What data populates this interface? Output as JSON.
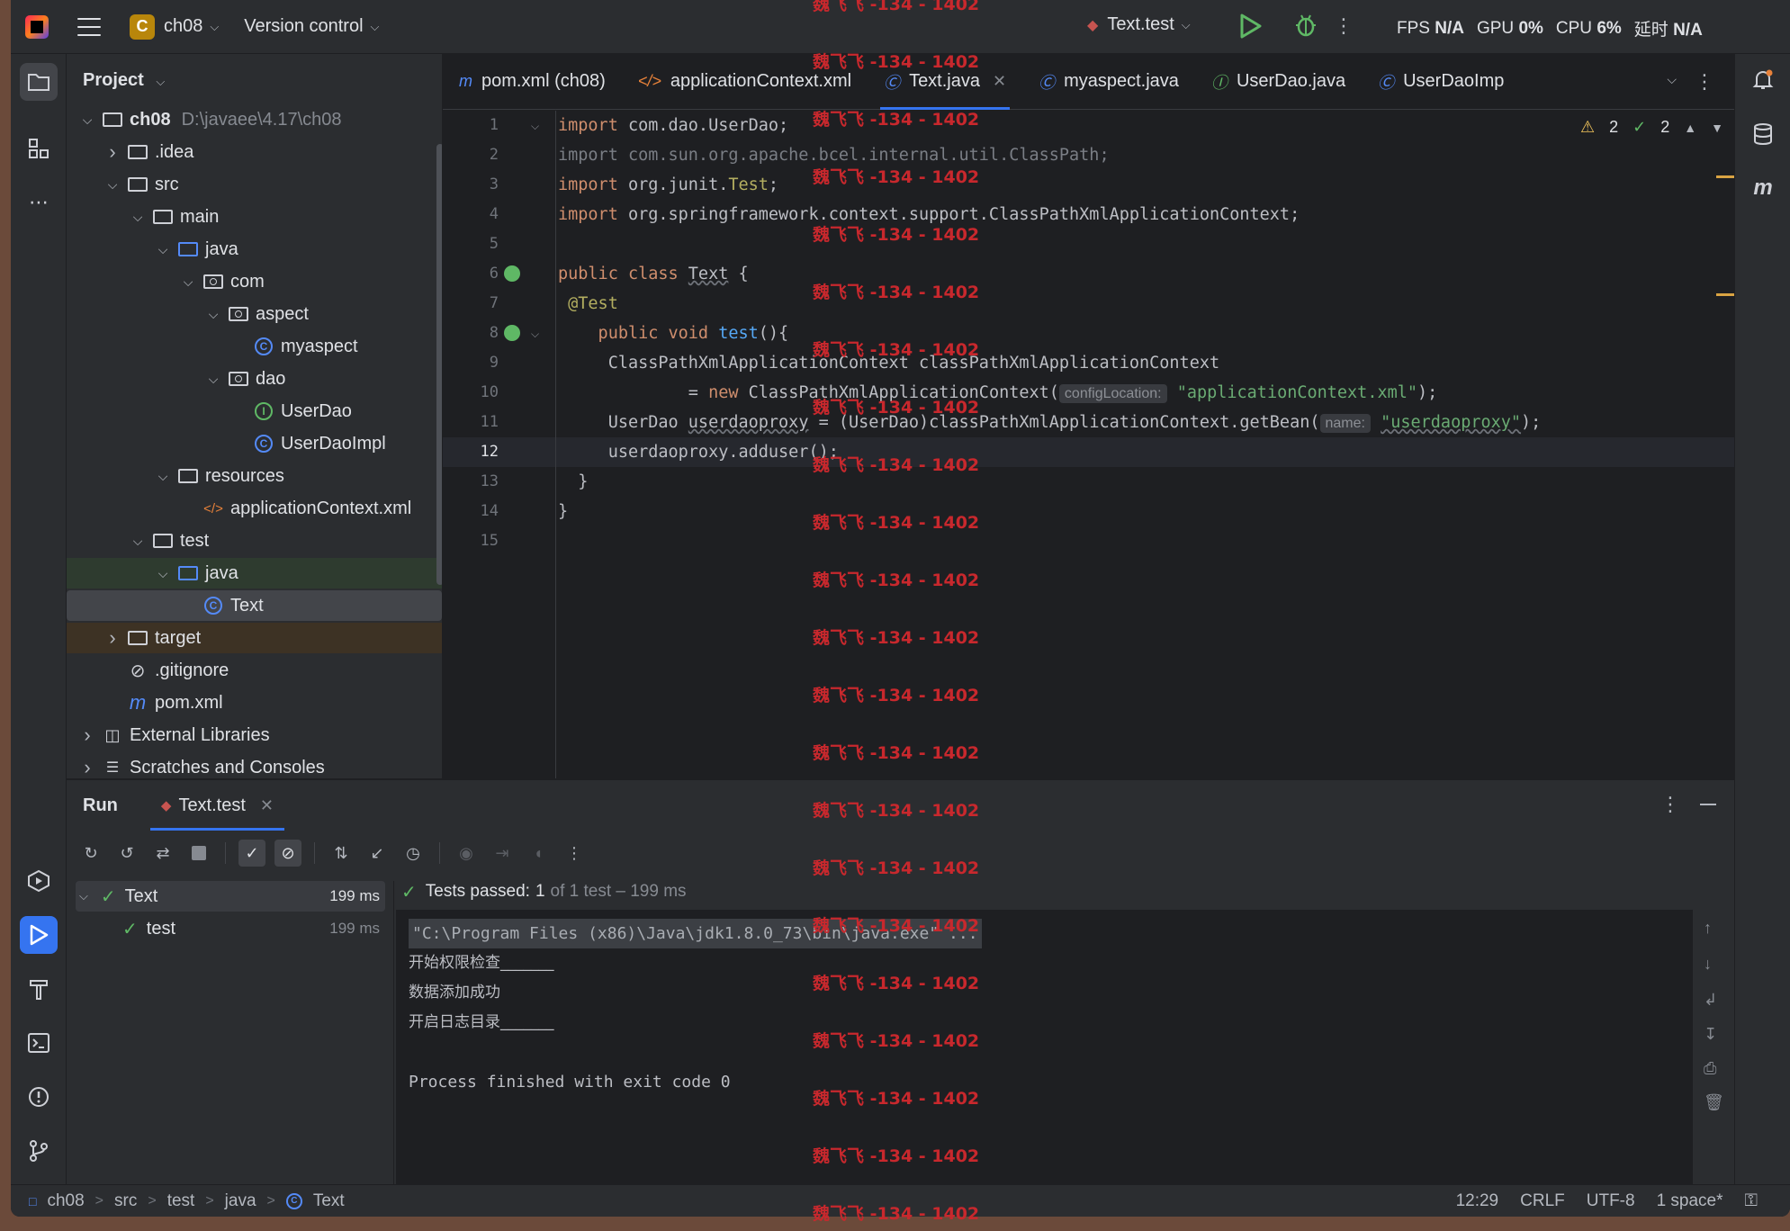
{
  "titlebar": {
    "project_badge": "C",
    "project_name": "ch08",
    "version_control": "Version control",
    "run_config": "Text.test",
    "perf": {
      "fps_label": "FPS",
      "fps_value": "N/A",
      "gpu_label": "GPU",
      "gpu_value": "0%",
      "cpu_label": "CPU",
      "cpu_value": "6%",
      "latency_label": "延时",
      "latency_value": "N/A"
    }
  },
  "project_panel": {
    "title": "Project",
    "tree": [
      {
        "label": "ch08",
        "path": "D:\\javaee\\4.17\\ch08",
        "type": "module",
        "depth": 0,
        "expanded": true
      },
      {
        "label": ".idea",
        "type": "folder",
        "depth": 1,
        "expanded": false
      },
      {
        "label": "src",
        "type": "folder",
        "depth": 1,
        "expanded": true
      },
      {
        "label": "main",
        "type": "folder",
        "depth": 2,
        "expanded": true
      },
      {
        "label": "java",
        "type": "source-folder",
        "depth": 3,
        "expanded": true
      },
      {
        "label": "com",
        "type": "package",
        "depth": 4,
        "expanded": true
      },
      {
        "label": "aspect",
        "type": "package",
        "depth": 5,
        "expanded": true
      },
      {
        "label": "myaspect",
        "type": "class",
        "depth": 6
      },
      {
        "label": "dao",
        "type": "package",
        "depth": 5,
        "expanded": true
      },
      {
        "label": "UserDao",
        "type": "interface",
        "depth": 6
      },
      {
        "label": "UserDaoImpl",
        "type": "class",
        "depth": 6
      },
      {
        "label": "resources",
        "type": "resources-folder",
        "depth": 3,
        "expanded": true
      },
      {
        "label": "applicationContext.xml",
        "type": "xml",
        "depth": 4
      },
      {
        "label": "test",
        "type": "folder",
        "depth": 2,
        "expanded": true
      },
      {
        "label": "java",
        "type": "test-folder",
        "depth": 3,
        "expanded": true
      },
      {
        "label": "Text",
        "type": "class",
        "depth": 4,
        "selected": true
      },
      {
        "label": "target",
        "type": "folder",
        "depth": 1,
        "expanded": false
      },
      {
        "label": ".gitignore",
        "type": "ignore",
        "depth": 1
      },
      {
        "label": "pom.xml",
        "type": "maven",
        "depth": 1
      },
      {
        "label": "External Libraries",
        "type": "libraries",
        "depth": 0,
        "expanded": false
      },
      {
        "label": "Scratches and Consoles",
        "type": "scratches",
        "depth": 0,
        "expanded": false
      }
    ]
  },
  "editor": {
    "tabs": [
      {
        "label": "pom.xml (ch08)",
        "icon": "maven-icon"
      },
      {
        "label": "applicationContext.xml",
        "icon": "xml-icon"
      },
      {
        "label": "Text.java",
        "icon": "class-icon",
        "active": true
      },
      {
        "label": "myaspect.java",
        "icon": "class-icon"
      },
      {
        "label": "UserDao.java",
        "icon": "interface-icon"
      },
      {
        "label": "UserDaoImp",
        "icon": "class-icon"
      }
    ],
    "warnings_count": "2",
    "ok_count": "2",
    "current_line": "12",
    "line_numbers": [
      "1",
      "2",
      "3",
      "4",
      "5",
      "6",
      "7",
      "8",
      "9",
      "10",
      "11",
      "12",
      "13",
      "14",
      "15"
    ],
    "code": {
      "l1_kw": "import",
      "l1_rest": " com.dao.UserDao;",
      "l2": "import com.sun.org.apache.bcel.internal.util.ClassPath;",
      "l3_kw": "import",
      "l3_mid": " org.junit.",
      "l3_ann": "Test",
      "l3_end": ";",
      "l4_kw": "import",
      "l4_rest": " org.springframework.context.support.ClassPathXmlApplicationContext;",
      "l6_kw": "public class",
      "l6_sp": " ",
      "l6_name": "Text",
      "l6_end": " {",
      "l7": " @Test",
      "l8_kw": "    public void",
      "l8_fn": " test",
      "l8_end": "(){",
      "l9": "     ClassPathXmlApplicationContext classPathXmlApplicationContext",
      "l10_pre": "             = ",
      "l10_kw": "new",
      "l10_mid": " ClassPathXmlApplicationContext(",
      "l10_hint": "configLocation:",
      "l10_str": "\"applicationContext.xml\"",
      "l10_end": ");",
      "l11_pre": "     UserDao ",
      "l11_var": "userdaoproxy",
      "l11_mid": " = (UserDao)classPathXmlApplicationContext.getBean(",
      "l11_hint": "name:",
      "l11_str": "\"userdaoproxy\"",
      "l11_end": ");",
      "l12": "     userdaoproxy.adduser();",
      "l13": "  }",
      "l14": "}"
    }
  },
  "run_panel": {
    "title": "Run",
    "tab": "Text.test",
    "tests": [
      {
        "name": "Text",
        "time": "199 ms"
      },
      {
        "name": "test",
        "time": "199 ms"
      }
    ],
    "summary_pass": "Tests passed:",
    "summary_count": "1",
    "summary_rest": "of 1 test – 199 ms",
    "console": {
      "cmd": "\"C:\\Program Files (x86)\\Java\\jdk1.8.0_73\\bin\\java.exe\" ...",
      "out1": "开始权限检查_______",
      "out2": "数据添加成功",
      "out3": "开启日志目录_______",
      "exit": "Process finished with exit code 0"
    }
  },
  "statusbar": {
    "breadcrumb": [
      "ch08",
      "src",
      "test",
      "java",
      "Text"
    ],
    "position": "12:29",
    "line_sep": "CRLF",
    "encoding": "UTF-8",
    "indent": "1 space*"
  },
  "watermark": "魏飞飞 -134 - 1402"
}
